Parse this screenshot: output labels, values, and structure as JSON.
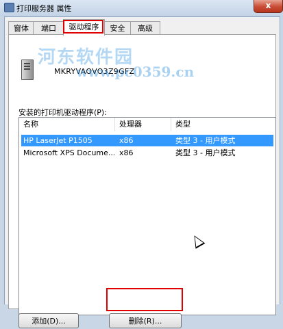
{
  "window": {
    "title": "打印服务器 属性",
    "close_label": "x"
  },
  "tabs": [
    {
      "label": "窗体"
    },
    {
      "label": "端口"
    },
    {
      "label": "驱动程序"
    },
    {
      "label": "安全"
    },
    {
      "label": "高级"
    }
  ],
  "active_tab_index": 2,
  "server": {
    "name": "MKRYVAOVO3Z9GFZ"
  },
  "watermark": {
    "logo": "河东软件园",
    "url": "www.pc0359.cn"
  },
  "drivers": {
    "label": "安装的打印机驱动程序(P):",
    "columns": [
      "名称",
      "处理器",
      "类型"
    ],
    "rows": [
      {
        "name": "HP LaserJet P1505",
        "processor": "x86",
        "type": "类型 3 - 用户模式",
        "selected": true
      },
      {
        "name": "Microsoft XPS Docume...",
        "processor": "x86",
        "type": "类型 3 - 用户模式",
        "selected": false
      }
    ]
  },
  "buttons": {
    "add": "添加(D)...",
    "remove": "删除(R)..."
  },
  "colors": {
    "selection": "#3399ff",
    "highlight_box": "#e00000"
  }
}
